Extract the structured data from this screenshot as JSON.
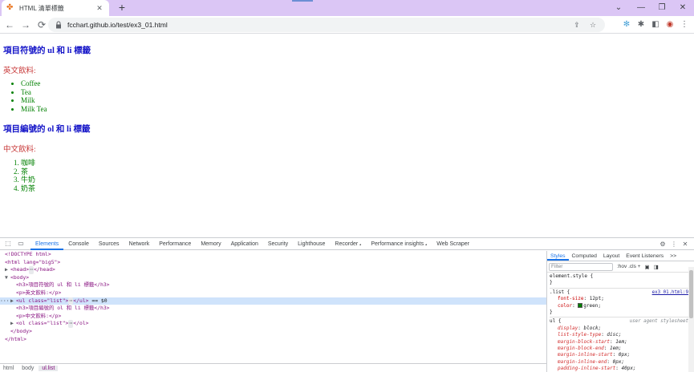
{
  "browser": {
    "tab_title": "HTML 清單標籤",
    "new_tab": "+",
    "tab_close": "✕",
    "favicon": "puzzle-favicon",
    "window": {
      "dropdown": "⌄",
      "minimize": "—",
      "maximize": "❐",
      "close": "✕"
    },
    "url": "fcchart.github.io/test/ex3_01.html"
  },
  "page": {
    "ul_heading": "項目符號的 ul 和 li 標籤",
    "ul_intro": "英文飲料:",
    "ul_items": [
      "Coffee",
      "Tea",
      "Milk",
      "Milk Tea"
    ],
    "ol_heading": "項目編號的 ol 和 li 標籤",
    "ol_intro": "中文飲料:",
    "ol_items": [
      "咖啡",
      "茶",
      "牛奶",
      "奶茶"
    ]
  },
  "devtools": {
    "tabs": [
      "Elements",
      "Console",
      "Sources",
      "Network",
      "Performance",
      "Memory",
      "Application",
      "Security",
      "Lighthouse",
      "Recorder 𝅘",
      "Performance insights 𝅘",
      "Web Scraper"
    ],
    "active_tab": "Elements",
    "dom": {
      "doctype": "<!DOCTYPE html>",
      "html_open": "<html lang=\"big5\">",
      "head": "<head>",
      "head_close": "</head>",
      "body_open": "<body>",
      "h3_1": "<h3>項目符號的 ul 和 li 標籤</h3>",
      "p_1": "<p>英文飲料:</p>",
      "ul_line_tag": "<ul class=\"list\">",
      "ul_line_close": "</ul>",
      "ul_line_marker": "== $0",
      "h3_2": "<h3>項目編號的 ol 和 li 標籤</h3>",
      "p_2": "<p>中文飲料:</p>",
      "ol_line_tag": "<ol class=\"list\">",
      "ol_line_close": "</ol>",
      "body_close": "</body>",
      "html_close": "</html>",
      "ellipsis": "⋯",
      "gutter_dots": "···"
    },
    "breadcrumbs": [
      "html",
      "body",
      "ul.list"
    ],
    "styles_tabs": [
      "Styles",
      "Computed",
      "Layout",
      "Event Listeners",
      ">>"
    ],
    "filter_placeholder": "Filter",
    "filter_tools": ":hov  .cls  +",
    "rules": {
      "element_style_selector": "element.style {",
      "close_brace": "}",
      "list_selector": ".list {",
      "list_source": "ex3_01.html:9",
      "list_font_size_name": "font-size",
      "list_font_size_value": "12pt;",
      "list_color_name": "color",
      "list_color_value": "green;",
      "ul_selector": "ul {",
      "ul_source": "user agent stylesheet",
      "ua_props": [
        {
          "name": "display",
          "value": "block;"
        },
        {
          "name": "list-style-type",
          "value": "disc;"
        },
        {
          "name": "margin-block-start",
          "value": "1em;"
        },
        {
          "name": "margin-block-end",
          "value": "1em;"
        },
        {
          "name": "margin-inline-start",
          "value": "0px;"
        },
        {
          "name": "margin-inline-end",
          "value": "0px;"
        },
        {
          "name": "padding-inline-start",
          "value": "40px;"
        }
      ]
    }
  },
  "colors": {
    "tabstrip": "#dbc6f5",
    "heading": "#1515c8",
    "paragraph": "#c83a3a",
    "list": "#008000",
    "accent": "#1a73e8"
  }
}
